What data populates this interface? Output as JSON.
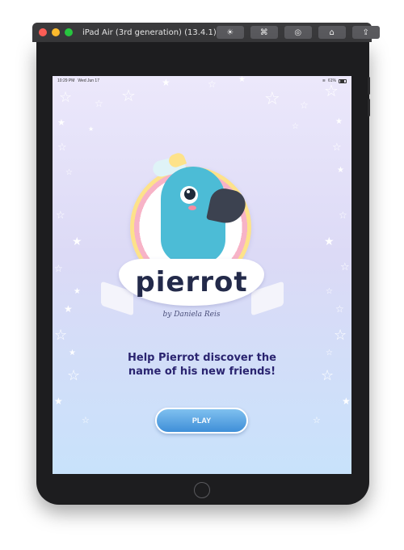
{
  "simulator": {
    "title": "iPad Air (3rd generation) (13.4.1)",
    "traffic_colors": [
      "#ff5f57",
      "#febc2e",
      "#28c840"
    ],
    "tools": [
      "☀",
      "⌘",
      "◎",
      "⌂",
      "⇪"
    ]
  },
  "status_bar": {
    "time": "10:29 PM",
    "date": "Wed Jun 17",
    "battery": "61%"
  },
  "logo": {
    "title": "pierrot",
    "byline": "by Daniela Reis"
  },
  "tagline": {
    "line1": "Help Pierrot discover the",
    "line2": "name of his new friends!"
  },
  "play_button": {
    "label": "PLAY"
  },
  "colors": {
    "accent": "#4a9be0",
    "text": "#2a2470"
  }
}
